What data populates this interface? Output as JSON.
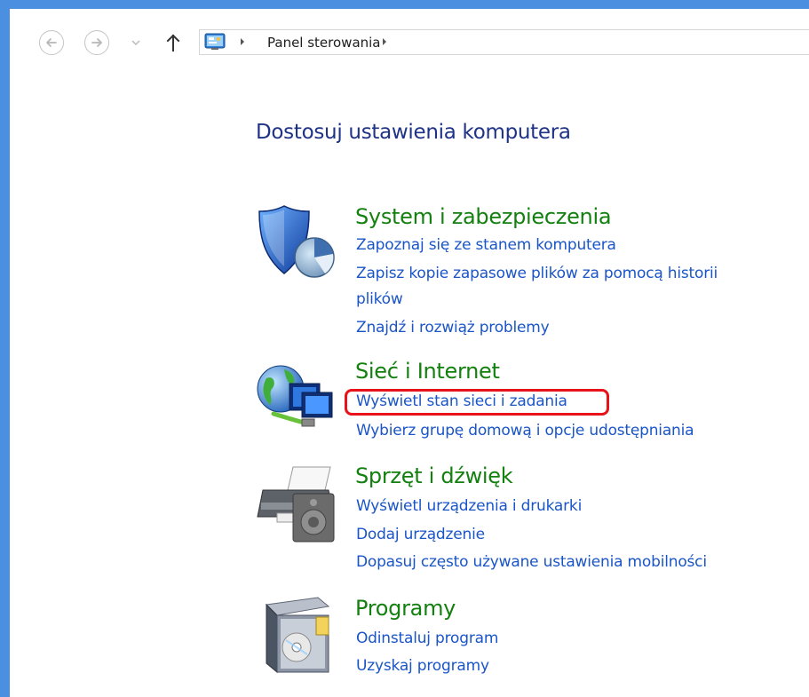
{
  "nav": {
    "back_icon": "back-arrow-icon",
    "forward_icon": "forward-arrow-icon",
    "recent_icon": "chevron-down-icon",
    "up_icon": "up-arrow-icon"
  },
  "address_bar": {
    "location_icon": "control-panel-icon",
    "breadcrumb": "Panel sterowania"
  },
  "main": {
    "title": "Dostosuj ustawienia komputera",
    "categories": [
      {
        "icon": "shield-icon",
        "title": "System i zabezpieczenia",
        "links": [
          "Zapoznaj się ze stanem komputera",
          "Zapisz kopie zapasowe plików za pomocą historii",
          "plików",
          "Znajdź i rozwiąż problemy"
        ]
      },
      {
        "icon": "network-globe-icon",
        "title": "Sieć i Internet",
        "links": [
          "Wyświetl stan sieci i zadania",
          "Wybierz grupę domową i opcje udostępniania"
        ]
      },
      {
        "icon": "printer-speaker-icon",
        "title": "Sprzęt i dźwięk",
        "links": [
          "Wyświetl urządzenia i drukarki",
          "Dodaj urządzenie",
          "Dopasuj często używane ustawienia mobilności"
        ]
      },
      {
        "icon": "programs-box-icon",
        "title": "Programy",
        "links": [
          "Odinstaluj program",
          "Uzyskaj programy"
        ]
      }
    ]
  },
  "colors": {
    "frame": "#4a8fe0",
    "title": "#1e3287",
    "category": "#13800f",
    "link": "#1a55c8",
    "highlight": "#e8121a"
  }
}
